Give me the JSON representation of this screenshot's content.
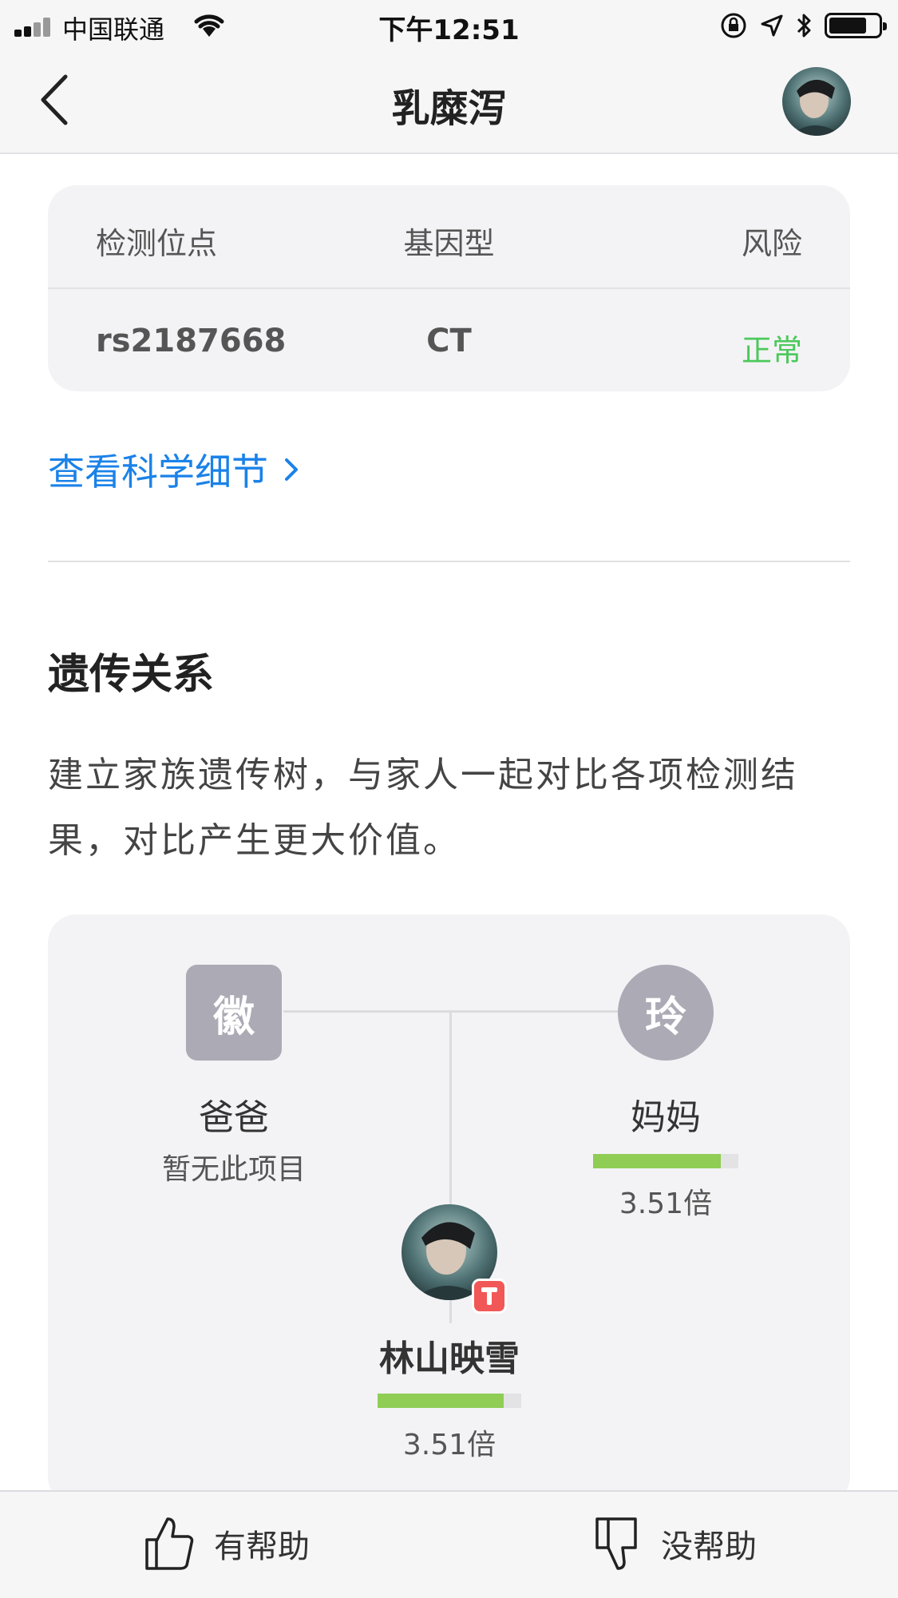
{
  "status_bar": {
    "carrier": "中国联通",
    "time": "下午12:51"
  },
  "nav": {
    "title": "乳糜泻"
  },
  "gene_table": {
    "headers": [
      "检测位点",
      "基因型",
      "风险"
    ],
    "row": {
      "site": "rs2187668",
      "genotype": "CT",
      "risk": "正常"
    },
    "risk_color": "#4cc85c"
  },
  "science_link": "查看科学细节",
  "inheritance": {
    "title": "遗传关系",
    "description": "建立家族遗传树，与家人一起对比各项检测结果，对比产生更大价值。"
  },
  "family_tree": {
    "father": {
      "avatar_char": "徽",
      "label": "爸爸",
      "note": "暂无此项目"
    },
    "mother": {
      "avatar_char": "玲",
      "label": "妈妈",
      "value": "3.51倍",
      "bar_fraction": 0.88
    },
    "me": {
      "label": "林山映雪",
      "value": "3.51倍",
      "bar_fraction": 0.88
    },
    "bar_color": "#8fcd55"
  },
  "feedback": {
    "helpful": "有帮助",
    "not_helpful": "没帮助"
  }
}
